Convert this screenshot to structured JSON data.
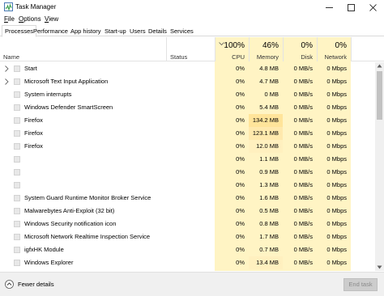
{
  "window": {
    "title": "Task Manager"
  },
  "menu": [
    {
      "label": "File",
      "underline": "F",
      "rest": "ile"
    },
    {
      "label": "Options",
      "underline": "O",
      "rest": "ptions"
    },
    {
      "label": "View",
      "underline": "V",
      "rest": "iew"
    }
  ],
  "tabs": [
    "Processes",
    "Performance",
    "App history",
    "Start-up",
    "Users",
    "Details",
    "Services"
  ],
  "active_tab": "Processes",
  "columns": {
    "name": {
      "label": "Name"
    },
    "status": {
      "label": "Status"
    },
    "cpu": {
      "pct": "100%",
      "label": "CPU"
    },
    "memory": {
      "pct": "46%",
      "label": "Memory"
    },
    "disk": {
      "pct": "0%",
      "label": "Disk"
    },
    "network": {
      "pct": "0%",
      "label": "Network"
    }
  },
  "processes": [
    {
      "name": "Start",
      "expandable": true,
      "cpu": "0%",
      "memory": "4.8 MB",
      "disk": "0 MB/s",
      "network": "0 Mbps"
    },
    {
      "name": "Microsoft Text Input Application",
      "expandable": true,
      "cpu": "0%",
      "memory": "4.7 MB",
      "disk": "0 MB/s",
      "network": "0 Mbps"
    },
    {
      "name": "System interrupts",
      "expandable": false,
      "cpu": "0%",
      "memory": "0 MB",
      "disk": "0 MB/s",
      "network": "0 Mbps"
    },
    {
      "name": "Windows Defender SmartScreen",
      "expandable": false,
      "cpu": "0%",
      "memory": "5.4 MB",
      "disk": "0 MB/s",
      "network": "0 Mbps"
    },
    {
      "name": "Firefox",
      "expandable": false,
      "cpu": "0%",
      "memory": "134.2 MB",
      "disk": "0 MB/s",
      "network": "0 Mbps"
    },
    {
      "name": "Firefox",
      "expandable": false,
      "cpu": "0%",
      "memory": "123.1 MB",
      "disk": "0 MB/s",
      "network": "0 Mbps"
    },
    {
      "name": "Firefox",
      "expandable": false,
      "cpu": "0%",
      "memory": "12.0 MB",
      "disk": "0 MB/s",
      "network": "0 Mbps"
    },
    {
      "name": "",
      "expandable": false,
      "cpu": "0%",
      "memory": "1.1 MB",
      "disk": "0 MB/s",
      "network": "0 Mbps"
    },
    {
      "name": "",
      "expandable": false,
      "cpu": "0%",
      "memory": "0.9 MB",
      "disk": "0 MB/s",
      "network": "0 Mbps"
    },
    {
      "name": "",
      "expandable": false,
      "cpu": "0%",
      "memory": "1.3 MB",
      "disk": "0 MB/s",
      "network": "0 Mbps"
    },
    {
      "name": "System Guard Runtime Monitor Broker Service",
      "expandable": false,
      "cpu": "0%",
      "memory": "1.6 MB",
      "disk": "0 MB/s",
      "network": "0 Mbps"
    },
    {
      "name": "Malwarebytes Anti-Exploit (32 bit)",
      "expandable": false,
      "cpu": "0%",
      "memory": "0.5 MB",
      "disk": "0 MB/s",
      "network": "0 Mbps"
    },
    {
      "name": "Windows Security notification icon",
      "expandable": false,
      "cpu": "0%",
      "memory": "0.8 MB",
      "disk": "0 MB/s",
      "network": "0 Mbps"
    },
    {
      "name": "Microsoft Network Realtime Inspection Service",
      "expandable": false,
      "cpu": "0%",
      "memory": "1.7 MB",
      "disk": "0 MB/s",
      "network": "0 Mbps"
    },
    {
      "name": "igfxHK Module",
      "expandable": false,
      "cpu": "0%",
      "memory": "0.7 MB",
      "disk": "0 MB/s",
      "network": "0 Mbps"
    },
    {
      "name": "Windows Explorer",
      "expandable": false,
      "cpu": "0%",
      "memory": "13.4 MB",
      "disk": "0 MB/s",
      "network": "0 Mbps"
    }
  ],
  "footer": {
    "fewer_details": "Fewer details",
    "end_task": "End task"
  },
  "colors": {
    "heat_light": "#fff4c4",
    "heat_medium": "#ffe8a3",
    "selection_border": "#d9d9d9"
  }
}
